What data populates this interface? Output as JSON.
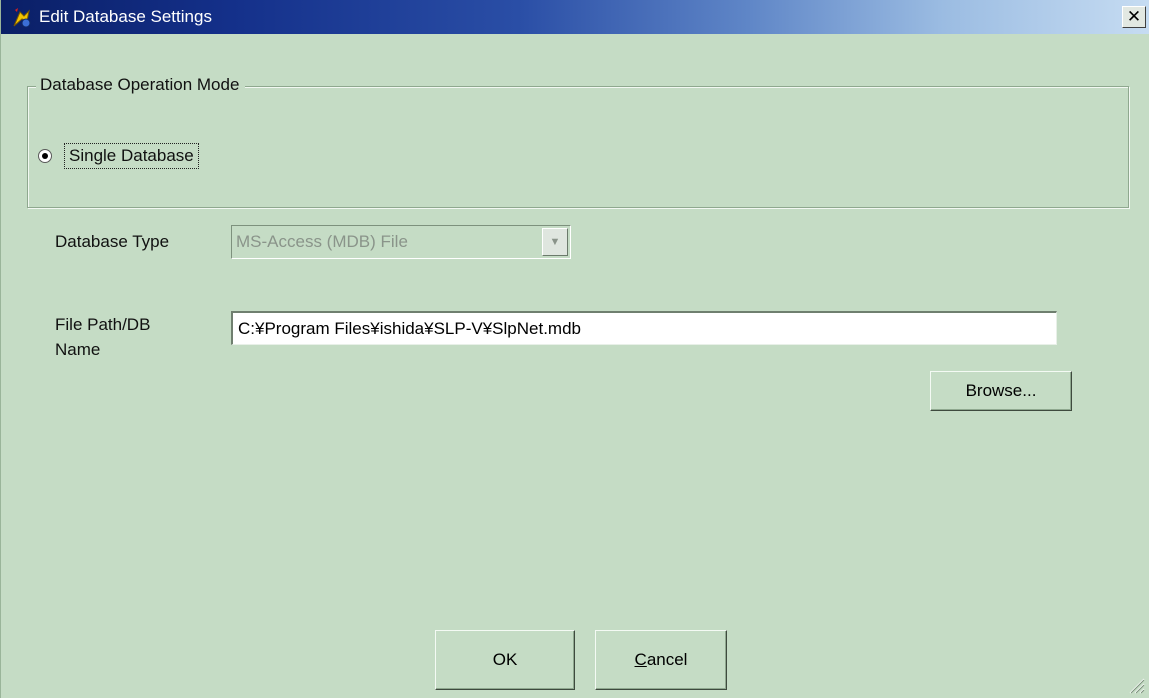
{
  "window": {
    "title": "Edit Database Settings",
    "close_glyph": "✕"
  },
  "operation_mode": {
    "legend": "Database Operation Mode",
    "option_label": "Single Database",
    "selected": true
  },
  "database_type": {
    "label": "Database Type",
    "value": "MS-Access (MDB) File",
    "enabled": false
  },
  "file_path": {
    "label_line1": "File Path/DB",
    "label_line2": "Name",
    "value": "C:¥Program Files¥ishida¥SLP-V¥SlpNet.mdb"
  },
  "buttons": {
    "browse": "Browse...",
    "ok": "OK",
    "cancel_mnemonic": "C",
    "cancel_rest": "ancel"
  },
  "colors": {
    "dialog_background": "#c5dcc5",
    "title_gradient_start": "#0a1f66",
    "title_gradient_end": "#c6dcf2"
  },
  "icons": {
    "title": "app-icon",
    "close": "close-icon",
    "dropdown": "chevron-down-icon",
    "resize": "resize-grip-icon"
  }
}
